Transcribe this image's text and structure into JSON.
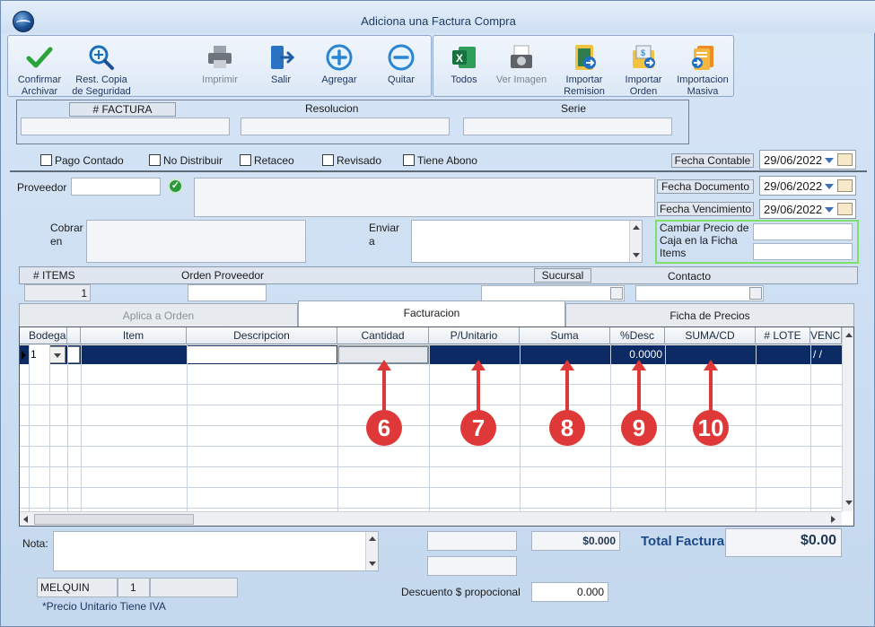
{
  "window": {
    "title": "Adiciona una Factura Compra"
  },
  "toolbar": {
    "confirm": "Confirmar Archivar",
    "backup": "Rest. Copia de Seguridad",
    "print": "Imprimir",
    "exit": "Salir",
    "add": "Agregar",
    "remove": "Quitar",
    "excel": "Todos",
    "image": "Ver Imagen",
    "remission": "Importar Remision",
    "order": "Importar Orden",
    "bulk": "Importacion Masiva"
  },
  "header": {
    "factura": "# FACTURA",
    "resolucion": "Resolucion",
    "serie": "Serie"
  },
  "checks": {
    "contado": "Pago Contado",
    "nodist": "No Distribuir",
    "retaceo": "Retaceo",
    "revisado": "Revisado",
    "abono": "Tiene Abono"
  },
  "dates": {
    "contable_label": "Fecha Contable",
    "contable": "29/06/2022",
    "documento_label": "Fecha Documento",
    "documento": "29/06/2022",
    "vencimiento_label": "Fecha Vencimiento",
    "vencimiento": "29/06/2022"
  },
  "form": {
    "proveedor": "Proveedor",
    "cobrar": "Cobrar en",
    "enviar": "Enviar a",
    "cambiar": "Cambiar Precio de Caja en la Ficha Items"
  },
  "info": {
    "items_label": "# ITEMS",
    "items_value": "1",
    "orden": "Orden Proveedor",
    "sucursal": "Sucursal",
    "contacto": "Contacto"
  },
  "tabs": [
    "Aplica a Orden",
    "Facturacion",
    "Ficha de Precios"
  ],
  "grid": {
    "columns": [
      "Bodega",
      "Item",
      "Descripcion",
      "Cantidad",
      "P/Unitario",
      "Suma",
      "%Desc",
      "SUMA/CD",
      "# LOTE",
      "VENC"
    ],
    "row": {
      "bodega": "1",
      "desc": "0.0000",
      "venc": "/ /"
    }
  },
  "markers": [
    "6",
    "7",
    "8",
    "9",
    "10"
  ],
  "footer": {
    "nota": "Nota:",
    "suma_total": "$0.000",
    "total_label": "Total Factura",
    "total_value": "$0.00",
    "descuento_label": "Descuento $ propocional",
    "descuento_value": "0.000",
    "user": "MELQUIN",
    "user_num": "1",
    "iva_note": "*Precio Unitario Tiene IVA"
  },
  "colors": {
    "accent": "#0c2a63",
    "marker": "#de3838",
    "green_border": "#7ee06a"
  }
}
